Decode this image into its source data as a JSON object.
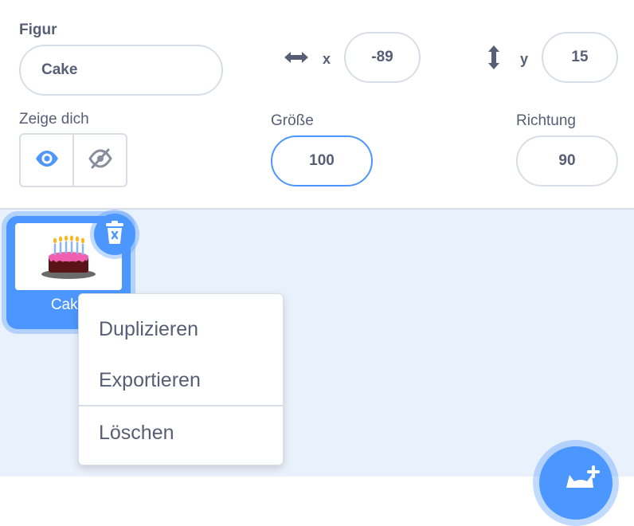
{
  "colors": {
    "accent": "#4c97ff",
    "text": "#575e75",
    "border": "#d9dde6",
    "pane": "#e9f1fc"
  },
  "sprite_info": {
    "sprite_label": "Figur",
    "sprite_name": "Cake",
    "x_label": "x",
    "x_value": "-89",
    "y_label": "y",
    "y_value": "15",
    "show_label": "Zeige dich",
    "show_icon": "eye-icon",
    "hide_icon": "eye-slash-icon",
    "size_label": "Größe",
    "size_value": "100",
    "direction_label": "Richtung",
    "direction_value": "90"
  },
  "sprite_list": {
    "items": [
      {
        "name": "Cake",
        "icon": "birthday-cake-thumbnail",
        "selected": true
      }
    ],
    "delete_icon": "trash-icon",
    "add_sprite_icon": "add-sprite-icon"
  },
  "context_menu": {
    "items": [
      {
        "label": "Duplizieren"
      },
      {
        "label": "Exportieren"
      },
      {
        "label": "Löschen"
      }
    ]
  }
}
